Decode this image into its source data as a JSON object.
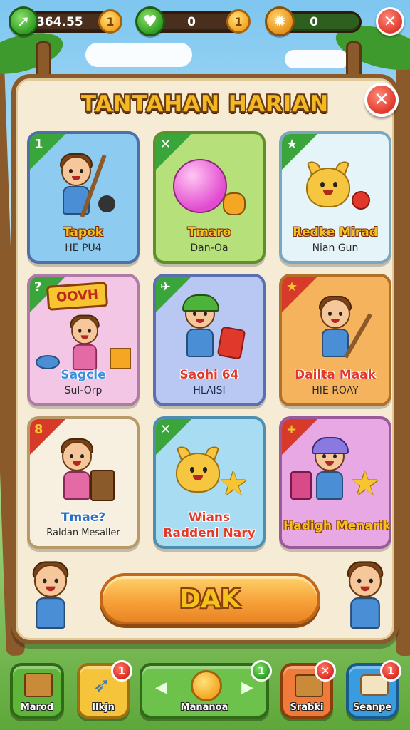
{
  "top_bar": {
    "resources": [
      {
        "icon": "leaf-arrow-icon",
        "value": "364.55",
        "coin": "1"
      },
      {
        "icon": "heart-leaf-icon",
        "value": "0",
        "coin": "1"
      },
      {
        "icon": "cookie-icon",
        "value": "0",
        "coin": ""
      }
    ],
    "close_glyph": "✕"
  },
  "panel": {
    "title": "TANTAHAN HARIAN",
    "close_glyph": "✕",
    "cards": [
      {
        "corner": "1",
        "name": "Tapok",
        "subtitle": "HE PU4",
        "bg": "#8ecbf0",
        "corner_color": "#3aa53a"
      },
      {
        "corner": "✕",
        "name": "Tmaro",
        "subtitle": "Dan-Oa",
        "bg": "#b5e07a",
        "corner_color": "#3aa53a"
      },
      {
        "corner": "★",
        "name": "Redke Mirad",
        "subtitle": "Nian Gun",
        "bg": "#e4f4f9",
        "corner_color": "#3aa53a"
      },
      {
        "corner": "?",
        "name": "Sagcle",
        "subtitle": "Sul-Orp",
        "bg": "#f3c6e6",
        "corner_color": "#3aa53a",
        "sign": "OOVH"
      },
      {
        "corner": "✈",
        "name": "Saohi 64",
        "subtitle": "HLAISI",
        "bg": "#b8c8f2",
        "corner_color": "#3aa53a"
      },
      {
        "corner": "★",
        "name": "Dailta Maak",
        "subtitle": "HIE ROAY",
        "bg": "#f5b35e",
        "corner_color": "#d83a2a"
      },
      {
        "corner": "8",
        "name": "Tmae?",
        "subtitle": "Raldan Mesaller",
        "bg": "#f7efe0",
        "corner_color": "#d83a2a"
      },
      {
        "corner": "✕",
        "name": "Wians",
        "subtitle": "Raddenl Nary",
        "bg": "#a7dcf2",
        "corner_color": "#3aa53a"
      },
      {
        "corner": "+",
        "name": "Hadigh Menarik",
        "subtitle": "",
        "bg": "#e7a8e3",
        "corner_color": "#d83a2a"
      }
    ],
    "main_button": "DAK"
  },
  "bottom_nav": [
    {
      "label": "Marod",
      "icon": "treasure-box-icon",
      "badge": "",
      "bg": "#5fb43a"
    },
    {
      "label": "Ilkjn",
      "icon": "rocket-icon",
      "badge": "1",
      "bg": "#f5c43a"
    },
    {
      "label": "Mananoa",
      "icon": "sun-orb-icon",
      "badge": "1",
      "bg": "#6cc24a"
    },
    {
      "label": "Srabki",
      "icon": "gift-box-icon",
      "badge": "✕",
      "bg": "#f07a3a"
    },
    {
      "label": "Seanpe",
      "icon": "scroll-icon",
      "badge": "1",
      "bg": "#3a9ce0"
    }
  ]
}
